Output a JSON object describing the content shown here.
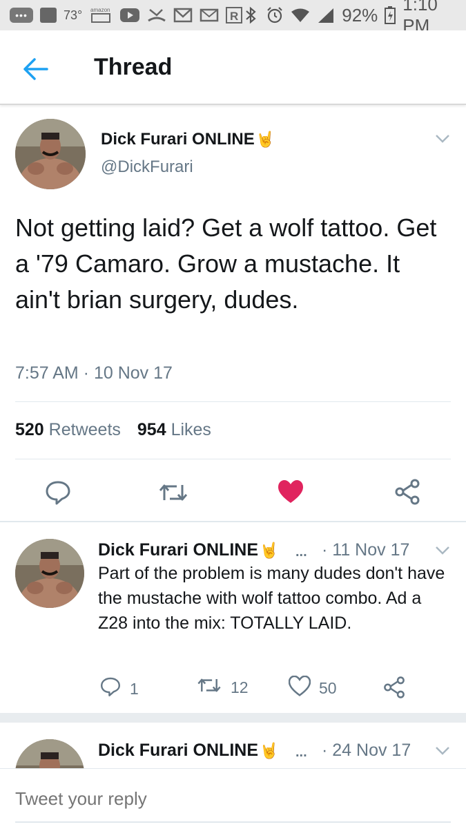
{
  "status_bar": {
    "temperature": "73°",
    "amazon_label": "amazon",
    "music_label": "music",
    "r_label": "R",
    "battery": "92%",
    "time": "1:10 PM"
  },
  "header": {
    "title": "Thread"
  },
  "main_tweet": {
    "author_name": "Dick Furari ONLINE",
    "author_emoji": "🤘",
    "handle": "@DickFurari",
    "text": "Not getting laid? Get a wolf tattoo. Get a '79 Camaro. Grow a mustache. It ain't brian surgery, dudes.",
    "timestamp": "7:57 AM · 10 Nov 17",
    "retweets_count": "520",
    "retweets_label": "Retweets",
    "likes_count": "954",
    "likes_label": "Likes",
    "liked": true
  },
  "replies": [
    {
      "author_name": "Dick Furari ONLINE",
      "author_emoji": "🤘",
      "dots": "...",
      "date": "· 11 Nov 17",
      "text": "Part of the problem is many dudes don't have the mustache with wolf tattoo combo. Ad a Z28 into the mix: TOTALLY LAID.",
      "reply_count": "1",
      "retweet_count": "12",
      "like_count": "50"
    },
    {
      "author_name": "Dick Furari ONLINE",
      "author_emoji": "🤘",
      "dots": "...",
      "date": "· 24 Nov 17"
    }
  ],
  "reply_bar": {
    "placeholder": "Tweet your reply"
  },
  "colors": {
    "accent": "#1da1f2",
    "secondary_text": "#657786",
    "like_red": "#e0245e",
    "divider": "#e1e8ed"
  },
  "icons": [
    "back-arrow-icon",
    "chevron-down-icon",
    "reply-icon",
    "retweet-icon",
    "heart-icon",
    "share-icon",
    "bluetooth-icon",
    "alarm-icon",
    "wifi-icon",
    "signal-icon",
    "battery-icon"
  ]
}
